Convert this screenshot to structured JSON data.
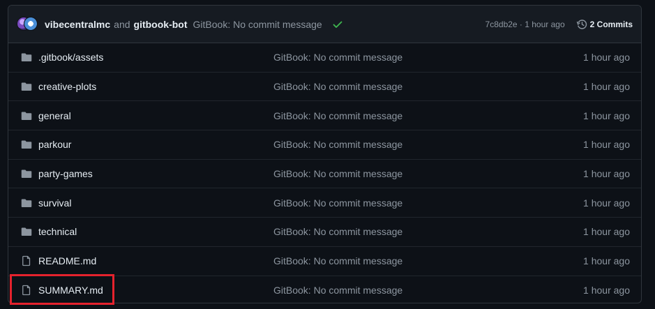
{
  "latest_commit": {
    "author1": "vibecentralmc",
    "connector": "and",
    "author2": "gitbook-bot",
    "message": "GitBook: No commit message",
    "hash_time": "7c8db2e · 1 hour ago",
    "commits_label": "2 Commits",
    "status_icon": "check-icon",
    "history_icon": "history-icon"
  },
  "files": [
    {
      "name": ".gitbook/assets",
      "type": "folder",
      "message": "GitBook: No commit message",
      "time": "1 hour ago"
    },
    {
      "name": "creative-plots",
      "type": "folder",
      "message": "GitBook: No commit message",
      "time": "1 hour ago"
    },
    {
      "name": "general",
      "type": "folder",
      "message": "GitBook: No commit message",
      "time": "1 hour ago"
    },
    {
      "name": "parkour",
      "type": "folder",
      "message": "GitBook: No commit message",
      "time": "1 hour ago"
    },
    {
      "name": "party-games",
      "type": "folder",
      "message": "GitBook: No commit message",
      "time": "1 hour ago"
    },
    {
      "name": "survival",
      "type": "folder",
      "message": "GitBook: No commit message",
      "time": "1 hour ago"
    },
    {
      "name": "technical",
      "type": "folder",
      "message": "GitBook: No commit message",
      "time": "1 hour ago"
    },
    {
      "name": "README.md",
      "type": "file",
      "message": "GitBook: No commit message",
      "time": "1 hour ago"
    },
    {
      "name": "SUMMARY.md",
      "type": "file",
      "message": "GitBook: No commit message",
      "time": "1 hour ago"
    }
  ],
  "colors": {
    "background": "#0d1117",
    "header": "#161b22",
    "border": "#30363d",
    "muted_text": "#8d96a0",
    "success_check": "#3fb950",
    "highlight_box": "#e5222d"
  },
  "highlighted_file": "SUMMARY.md"
}
